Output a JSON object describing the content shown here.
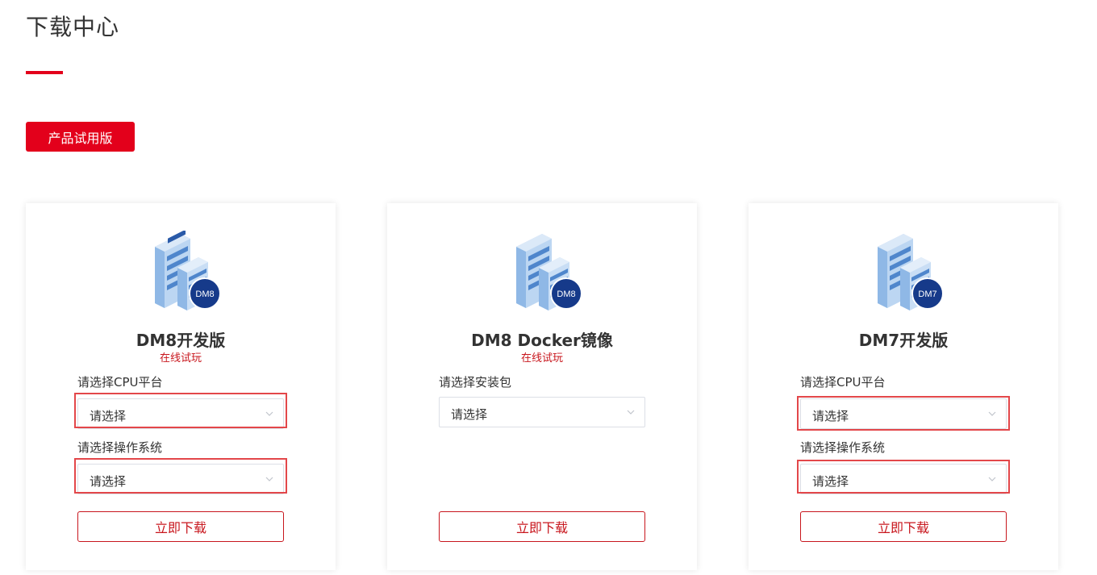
{
  "header": {
    "title": "下载中心",
    "accent_color": "#e3001b"
  },
  "tab": {
    "label": "产品试用版"
  },
  "cards": [
    {
      "badge": "DM8",
      "name": "DM8开发版",
      "link": "在线试玩",
      "fields": [
        {
          "label": "请选择CPU平台",
          "value": "请选择"
        },
        {
          "label": "请选择操作系统",
          "value": "请选择"
        }
      ],
      "download": "立即下载"
    },
    {
      "badge": "DM8",
      "name": "DM8 Docker镜像",
      "link": "在线试玩",
      "fields": [
        {
          "label": "请选择安装包",
          "value": "请选择"
        }
      ],
      "download": "立即下载"
    },
    {
      "badge": "DM7",
      "name": "DM7开发版",
      "fields": [
        {
          "label": "请选择CPU平台",
          "value": "请选择"
        },
        {
          "label": "请选择操作系统",
          "value": "请选择"
        }
      ],
      "download": "立即下载"
    }
  ],
  "colors": {
    "link": "#c8161d",
    "highlight": "#e3474a",
    "badge": "#163a8a",
    "server": "#8fb8e6"
  }
}
